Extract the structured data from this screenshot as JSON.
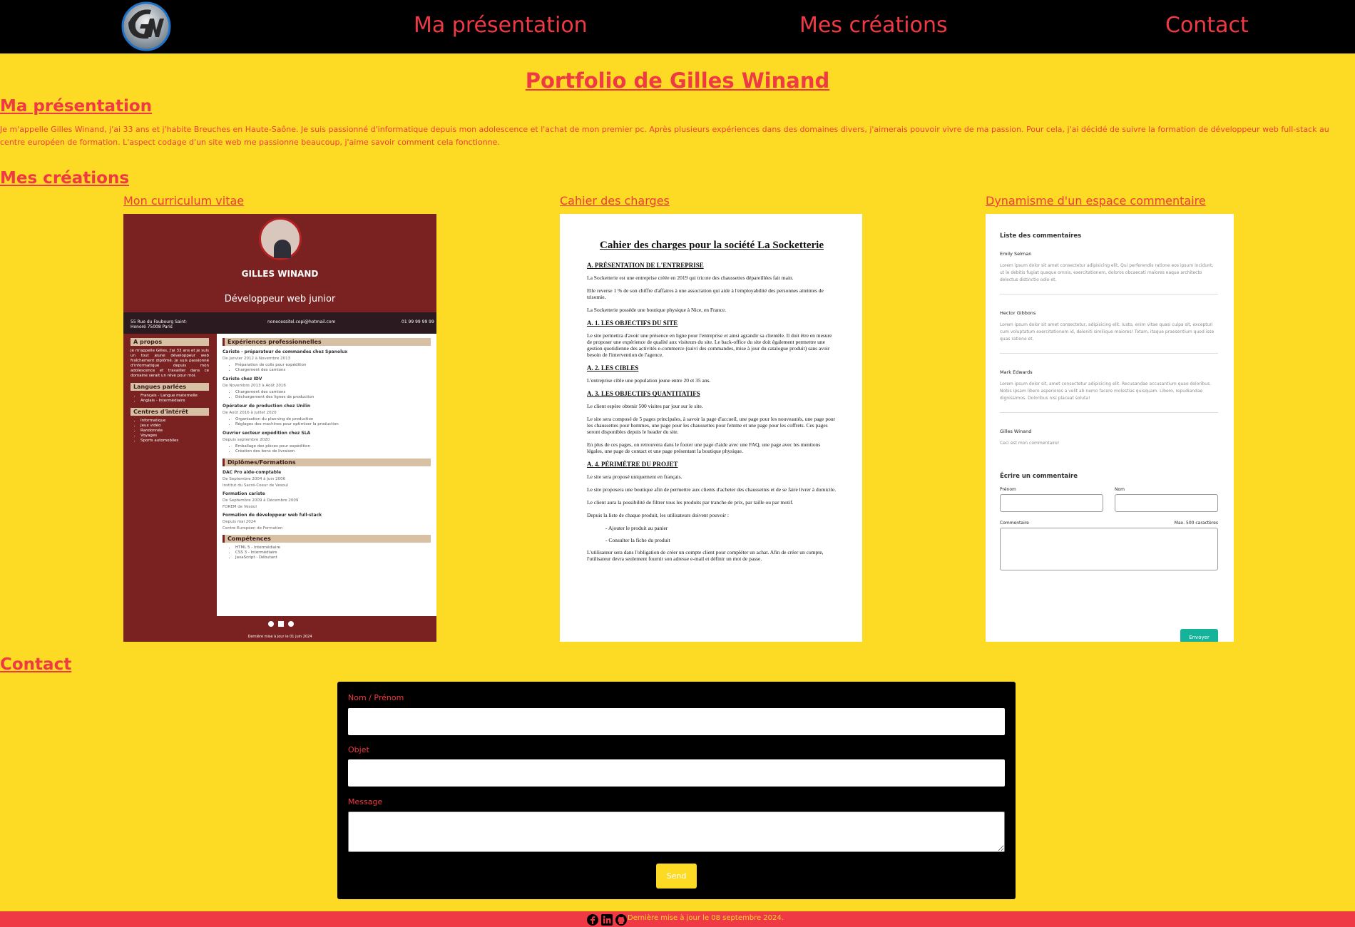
{
  "nav": {
    "items": [
      "Ma présentation",
      "Mes créations",
      "Contact"
    ]
  },
  "page_title": "Portfolio de Gilles Winand",
  "presentation": {
    "title": "Ma présentation",
    "text": "Je m'appelle Gilles Winand, j'ai 33 ans et j'habite Breuches en Haute-Saône. Je suis passionné d'informatique depuis mon adolescence et l'achat de mon premier pc. Après plusieurs expériences dans des domaines divers, j'aimerais pouvoir vivre de ma passion. Pour cela, j'ai décidé de suivre la formation de développeur web full-stack au centre européen de formation. L'aspect codage d'un site web me passionne beaucoup, j'aime savoir comment cela fonctionne."
  },
  "creations": {
    "title": "Mes créations",
    "cards": [
      "Mon curriculum vitae",
      "Cahier des charges",
      "Dynamisme d'un espace commentaire"
    ]
  },
  "cv": {
    "name": "GILLES WINAND",
    "role": "Développeur web junior",
    "address": "55 Rue du Faubourg Saint-Honoré 75008 Paris",
    "email": "nonecessitel.copi@hotmail.com",
    "phone": "01 99 99 99 99",
    "about_title": "A propos",
    "about_text": "Je m'appelle Gilles, j'ai 33 ans et je suis un tout jeune développeur web fraîchement diplômé. Je suis passionné d'informatique depuis mon adolescence et travailler dans ce domaine serait un rêve pour moi.",
    "lang_title": "Langues parlées",
    "languages": [
      "Français - Langue maternelle",
      "Anglais - Intermédiaire"
    ],
    "interests_title": "Centres d'intérêt",
    "interests": [
      "Informatique",
      "Jeux vidéo",
      "Randonnée",
      "Voyages",
      "Sports automobiles"
    ],
    "exp_title": "Expériences professionnelles",
    "jobs": [
      {
        "title": "Cariste - préparateur de commandes chez Spanolux",
        "dates": "De Janvier 2012 à Novembre 2013",
        "tasks": [
          "Préparation de colis pour expédition",
          "Chargement des camions"
        ]
      },
      {
        "title": "Cariste chez IDV",
        "dates": "De Novembre 2013 à Août 2016",
        "tasks": [
          "Chargement des camions",
          "Déchargement des lignes de production"
        ]
      },
      {
        "title": "Opérateur de production chez Unilin",
        "dates": "De Août 2016 à Juillet 2020",
        "tasks": [
          "Organisation du planning de production",
          "Réglages des machines pour optimiser la production"
        ]
      },
      {
        "title": "Ouvrier secteur expédition chez SLA",
        "dates": "Depuis septembre 2020",
        "tasks": [
          "Emballage des pièces pour expédition",
          "Création des bons de livraison"
        ]
      }
    ],
    "diplomas_title": "Diplômes/Formations",
    "diplomas": [
      {
        "title": "DAC Pro aide-comptable",
        "lines": [
          "De Septembre 2004 à Juin 2006",
          "Institut du Sacré-Coeur de Vesoul"
        ]
      },
      {
        "title": "Formation cariste",
        "lines": [
          "De Septembre 2009 à Décembre 2009",
          "FOREM de Vesoul"
        ]
      },
      {
        "title": "Formation de développeur web full-stack",
        "lines": [
          "Depuis mai 2024",
          "Centre Européen de Formation"
        ]
      }
    ],
    "skills_title": "Compétences",
    "skills": [
      "HTML 5 - Intermédiaire",
      "CSS 3 - Intermédiaire",
      "JavaScript - Débutant"
    ],
    "footer": "Dernière mise à jour le 01 juin 2024"
  },
  "cdc": {
    "title": "Cahier des charges pour la société La Socketterie",
    "blocks": [
      {
        "h": "A. PRÉSENTATION DE L'ENTREPRISE"
      },
      {
        "p": "La Socketterie est une entreprise créée en 2019 qui tricote des chaussettes dépareillées fait main."
      },
      {
        "p": "Elle reverse 1 % de son chiffre d'affaires à une association qui aide à l'employabilité des personnes atteintes de trisomie."
      },
      {
        "p": "La Socketterie possède une boutique physique à Nice, en France."
      },
      {
        "h": "A. 1. LES OBJECTIFS DU SITE"
      },
      {
        "p": "Le site permettra d'avoir une présence en ligne pour l'entreprise et ainsi agrandir sa clientèle. Il doit être en mesure de proposer une expérience de qualité aux visiteurs du site. Le back-office du site doit également permettre une gestion quotidienne des activités e-commerce (suivi des commandes, mise à jour du catalogue produit) sans avoir besoin de l'intervention de l'agence."
      },
      {
        "h": "A. 2. LES CIBLES"
      },
      {
        "p": "L'entreprise cible une population jeune entre 20 et 35 ans."
      },
      {
        "h": "A. 3. LES OBJECTIFS QUANTITATIFS"
      },
      {
        "p": "Le client espère obtenir 500 visites par jour sur le site."
      },
      {
        "p": "Le site sera composé de 5 pages principales, à savoir la page d'accueil, une page pour les nouveautés, une page pour les chaussettes pour hommes, une page pour les chaussettes pour femme et une page pour les coffrets. Ces pages seront disponibles depuis le header du site."
      },
      {
        "p": "En plus de ces pages, on retrouvera dans le footer une page d'aide avec une FAQ, une page avec les mentions légales, une page de contact et une page présentant la boutique physique."
      },
      {
        "h": "A. 4. PÉRIMÈTRE DU PROJET"
      },
      {
        "p": "Le site sera proposé uniquement en français."
      },
      {
        "p": "Le site proposera une boutique afin de permettre aux clients d'acheter des chaussettes et de se faire livrer à domicile."
      },
      {
        "p": "Le client aura la possibilité de filtrer tous les produits par tranche de prix, par taille ou par motif."
      },
      {
        "p": "Depuis la liste de chaque produit, les utilisateurs doivent pouvoir :"
      },
      {
        "li": "- Ajouter le produit au panier"
      },
      {
        "li": "- Consulter la fiche du produit"
      },
      {
        "p": "L'utilisateur sera dans l'obligation de créer un compte client pour compléter un achat. Afin de créer un compte, l'utilisateur devra seulement fournir son adresse e-mail et définir un mot de passe."
      }
    ]
  },
  "comments": {
    "list_title": "Liste des commentaires",
    "items": [
      {
        "author": "Emily Selman",
        "text": "Lorem ipsum dolor sit amet consectetur adipisicing elit. Qui perferendis ratione eos ipsum incidunt, ut le debitis fugiat quaque omnis, exercitationem, doloros obcaecati malores eaque architecto delectus distinctio odio et."
      },
      {
        "author": "Hector Gibbons",
        "text": "Lorem ipsum dolor sit amet consectetur, adipisicing elit. Iusto, enim vitae quasi culpa sit, excepturi cum voluptatum exercitationem id, deleniti similique maiores! Totam, itaque praesentium quod isse quas ratione et."
      },
      {
        "author": "Mark Edwards",
        "text": "Lorem ipsum dolor sit, amet consectetur adipisicing elit. Recusandae accusantium quae doloribus. Nobis ipsam libero asperiores a velit ab nemo facere molestias quisquam. Libero, repudiandae dignissimos. Doloribus nisi placeat soluta!"
      },
      {
        "author": "Gilles Winand",
        "text": "Ceci est mon commentaire!"
      }
    ],
    "form_title": "Écrire un commentaire",
    "first_name_label": "Prénom",
    "last_name_label": "Nom",
    "comment_label": "Commentaire",
    "max_label": "Max. 500 caractères",
    "send_label": "Envoyer"
  },
  "contact": {
    "title": "Contact",
    "name_label": "Nom / Prénom",
    "subject_label": "Objet",
    "message_label": "Message",
    "send_label": "Send"
  },
  "footer": {
    "text": "Dernière mise à jour le 08 septembre 2024."
  },
  "colors": {
    "background": "#fddb24",
    "accent": "#ef3944",
    "nav_bg": "#000000",
    "cv_bg": "#7a2222"
  },
  "icons": [
    "gw-logo",
    "facebook-icon",
    "linkedin-icon",
    "github-icon"
  ]
}
